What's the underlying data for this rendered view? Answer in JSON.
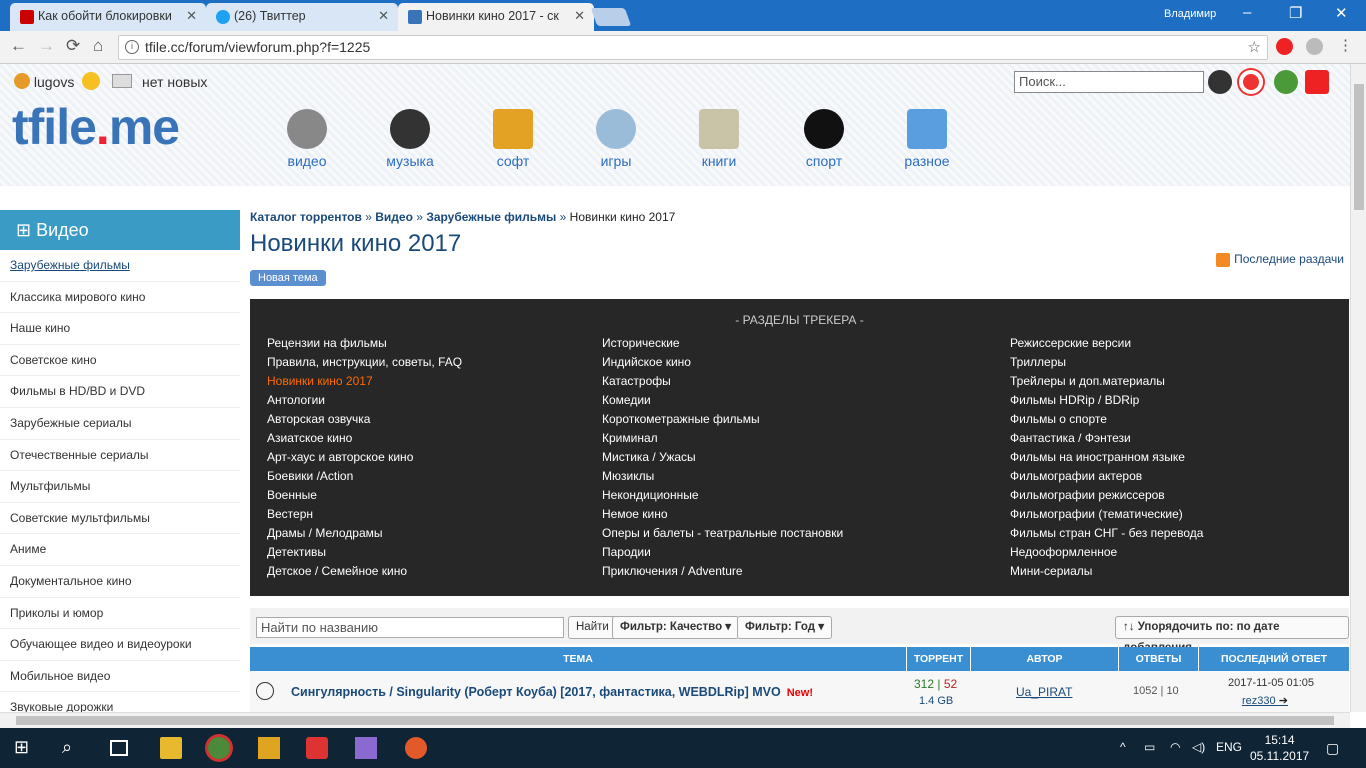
{
  "browser": {
    "tabs": [
      {
        "label": "Как обойти блокировки",
        "color": "#c00"
      },
      {
        "label": "(26) Твиттер",
        "color": "#1da1f2"
      },
      {
        "label": "Новинки кино 2017 - ск",
        "color": "#3a74b8"
      }
    ],
    "user": "Владимир",
    "url": "tfile.cc/forum/viewforum.php?f=1225"
  },
  "header": {
    "username": "lugovs",
    "messages": "нет новых",
    "logo_main": "tfile",
    "logo_dot": ".",
    "logo_tld": "me",
    "search_placeholder": "Поиск...",
    "categories": [
      "видео",
      "музыка",
      "софт",
      "игры",
      "книги",
      "спорт",
      "разное"
    ]
  },
  "sidebar": {
    "title": "Видео",
    "items": [
      "Зарубежные фильмы",
      "Классика мирового кино",
      "Наше кино",
      "Советское кино",
      "Фильмы в HD/BD и DVD",
      "Зарубежные сериалы",
      "Отечественные сериалы",
      "Мультфильмы",
      "Советские мультфильмы",
      "Аниме",
      "Документальное кино",
      "Приколы и юмор",
      "Обучающее видео и видеоуроки",
      "Мобильное видео",
      "Звуковые дорожки"
    ]
  },
  "content": {
    "breadcrumb": {
      "c1": "Каталог торрентов",
      "c2": "Видео",
      "c3": "Зарубежные фильмы",
      "c4": "Новинки кино 2017",
      "sep": "»"
    },
    "title": "Новинки кино 2017",
    "new_topic": "Новая тема",
    "rss": "Последние раздачи",
    "tracker_title": "- РАЗДЕЛЫ ТРЕКЕРА -",
    "col1": [
      "Рецензии на фильмы",
      "Правила, инструкции, советы, FAQ",
      "Новинки кино 2017",
      "Антологии",
      "Авторская озвучка",
      "Азиатское кино",
      "Арт-хаус и авторское кино",
      "Боевики /Action",
      "Военные",
      "Вестерн",
      "Драмы / Мелодрамы",
      "Детективы",
      "Детское / Семейное кино"
    ],
    "col2": [
      "Исторические",
      "Индийское кино",
      "Катастрофы",
      "Комедии",
      "Короткометражные фильмы",
      "Криминал",
      "Мистика / Ужасы",
      "Мюзиклы",
      "Некондиционные",
      "Немое кино",
      "Оперы и балеты - театральные постановки",
      "Пародии",
      "Приключения / Adventure"
    ],
    "col3": [
      "Режиссерские версии",
      "Триллеры",
      "Трейлеры и доп.материалы",
      "Фильмы HDRip / BDRip",
      "Фильмы о спорте",
      "Фантастика / Фэнтези",
      "Фильмы на иностранном языке",
      "Фильмографии актеров",
      "Фильмографии режиссеров",
      "Фильмографии (тематические)",
      "Фильмы стран СНГ - без перевода",
      "Недооформленное",
      "Мини-сериалы"
    ],
    "filter": {
      "placeholder": "Найти по названию",
      "find": "Найти",
      "quality": "Фильтр: Качество",
      "year": "Фильтр: Год",
      "sort": "↑↓ Упорядочить по: по дате добавления"
    },
    "table_headers": [
      "ТЕМА",
      "ТОРРЕНТ",
      "АВТОР",
      "ОТВЕТЫ",
      "ПОСЛЕДНИЙ ОТВЕТ"
    ],
    "row": {
      "title": "Сингулярность / Singularity (Роберт Коуба) [2017, фантастика, WEBDLRip] MVO",
      "badge": "New!",
      "seeds": "312",
      "leech": "52",
      "size": "1.4 GB",
      "author": "Ua_PIRAT",
      "answers": "1052 | 10",
      "last_date": "2017-11-05 01:05",
      "last_by": "rez330"
    }
  },
  "taskbar": {
    "lang": "ENG",
    "time": "15:14",
    "date": "05.11.2017"
  }
}
